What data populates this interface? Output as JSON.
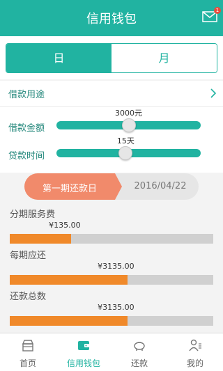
{
  "header": {
    "title": "信用钱包",
    "badge": "1",
    "icon": "mail-icon"
  },
  "period_tabs": [
    {
      "label": "日",
      "active": true
    },
    {
      "label": "月",
      "active": false
    }
  ],
  "purpose": {
    "label": "借款用途",
    "icon": "chevron-right-icon"
  },
  "amount_slider": {
    "label": "借款金额",
    "value_text": "3000元",
    "level_fraction": 0.5
  },
  "term_slider": {
    "label": "贷款时间",
    "value_text": "15天",
    "level_fraction": 0.48
  },
  "repayment": {
    "first_label": "第一期还款日",
    "date": "2016/04/22"
  },
  "bars": [
    {
      "label": "分期服务费",
      "amount": "¥135.00",
      "fraction": 0.3
    },
    {
      "label": "每期应还",
      "amount": "¥3135.00",
      "fraction": 0.58
    },
    {
      "label": "还款总数",
      "amount": "¥3135.00",
      "fraction": 0.58
    }
  ],
  "tabbar": [
    {
      "label": "首页",
      "icon": "home-icon",
      "active": false
    },
    {
      "label": "信用钱包",
      "icon": "wallet-icon",
      "active": true
    },
    {
      "label": "还款",
      "icon": "piggy-bank-icon",
      "active": false
    },
    {
      "label": "我的",
      "icon": "profile-icon",
      "active": false
    }
  ],
  "colors": {
    "primary": "#21b3a1",
    "orange": "#f0892a",
    "salmon": "#f18a6b"
  }
}
